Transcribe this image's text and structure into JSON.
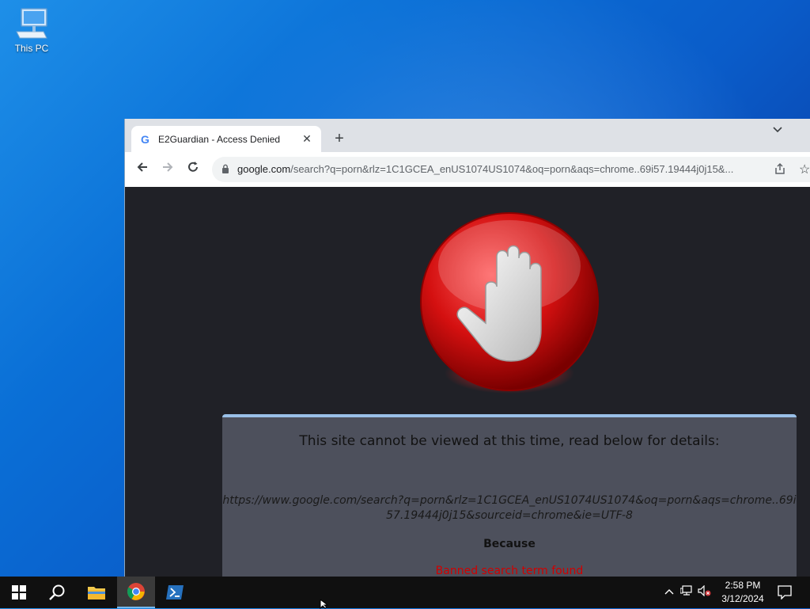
{
  "desktop": {
    "icons": [
      {
        "label": "This PC",
        "icon": "computer-icon"
      }
    ]
  },
  "browser": {
    "tab": {
      "title": "E2Guardian - Access Denied",
      "favicon": "G",
      "close": "✕"
    },
    "new_tab": "+",
    "tab_search": "⌄",
    "omnibox": {
      "host": "google.com",
      "path": "/search?q=porn&rlz=1C1GCEA_enUS1074US1074&oq=porn&aqs=chrome..69i57.19444j0j15&..."
    }
  },
  "page": {
    "heading": "This site cannot be viewed at this time, read below for details:",
    "blocked_url": "https://www.google.com/search?q=porn&rlz=1C1GCEA_enUS1074US1074&oq=porn&aqs=chrome..69i57.19444j0j15&sourceid=chrome&ie=UTF-8",
    "because_label": "Because",
    "reason": "Banned search term found"
  },
  "taskbar": {
    "items": [
      "start",
      "search",
      "file-explorer",
      "chrome",
      "powershell"
    ],
    "clock": {
      "time": "2:58 PM",
      "date": "3/12/2024"
    }
  },
  "colors": {
    "accent": "#76b9ed",
    "denied_red": "#d10000",
    "panel": "#4d505c"
  }
}
